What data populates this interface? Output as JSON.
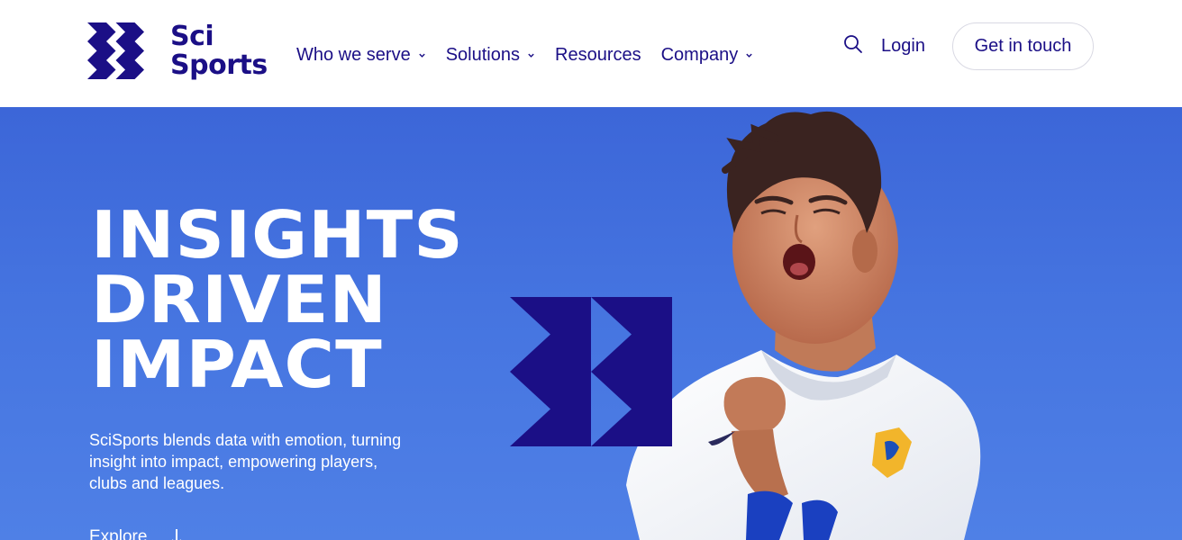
{
  "brand": {
    "name_line1": "Sci",
    "name_line2": "Sports",
    "color_primary": "#1b0f86",
    "color_hero": "#4574e0"
  },
  "nav": {
    "items": [
      {
        "label": "Who we serve",
        "has_dropdown": true
      },
      {
        "label": "Solutions",
        "has_dropdown": true
      },
      {
        "label": "Resources",
        "has_dropdown": false
      },
      {
        "label": "Company",
        "has_dropdown": true
      }
    ],
    "search_icon": "search-icon",
    "login_label": "Login",
    "cta_label": "Get in touch"
  },
  "hero": {
    "title_line1": "INSIGHTS",
    "title_line2": "DRIVEN",
    "title_line3": "IMPACT",
    "description": "SciSports blends data with emotion, turning insight into impact, empowering players, clubs and leagues.",
    "explore_label": "Explore",
    "explore_icon": "arrow-down-icon"
  }
}
